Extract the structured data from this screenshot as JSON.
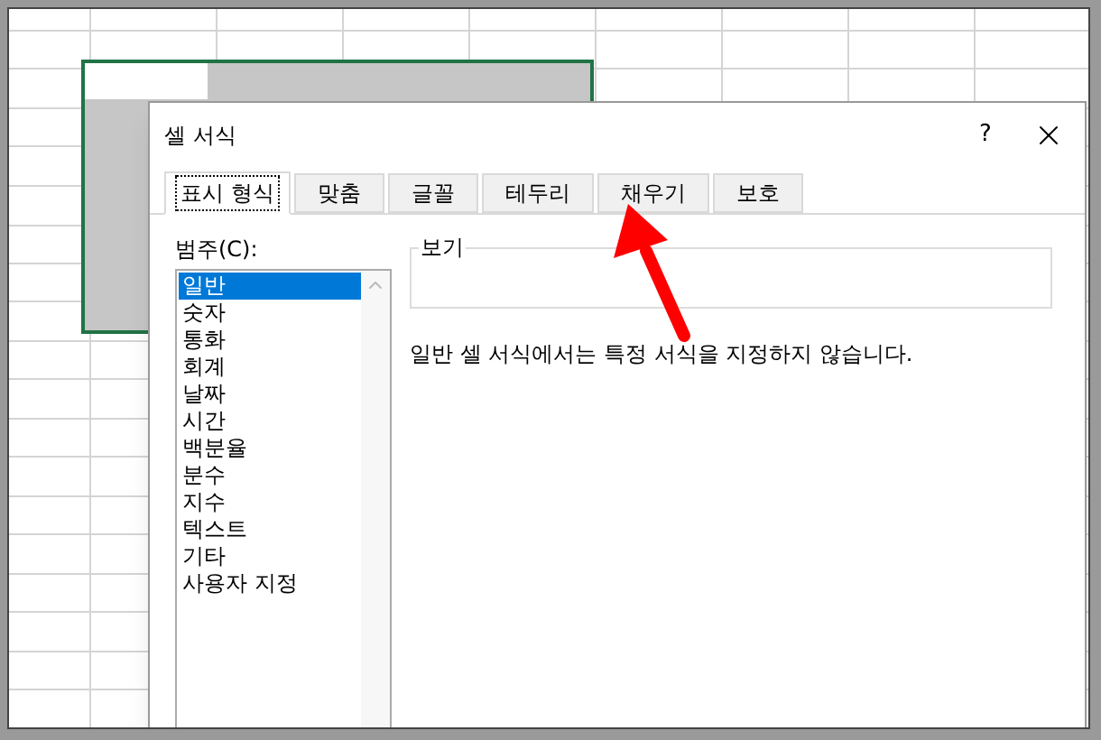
{
  "dialog": {
    "title": "셀 서식",
    "help": "?"
  },
  "tabs": [
    {
      "label": "표시 형식",
      "selected": true
    },
    {
      "label": "맞춤",
      "selected": false
    },
    {
      "label": "글꼴",
      "selected": false
    },
    {
      "label": "테두리",
      "selected": false
    },
    {
      "label": "채우기",
      "selected": false
    },
    {
      "label": "보호",
      "selected": false
    }
  ],
  "category": {
    "label": "범주(C):",
    "items": [
      {
        "label": "일반",
        "selected": true
      },
      {
        "label": "숫자",
        "selected": false
      },
      {
        "label": "통화",
        "selected": false
      },
      {
        "label": "회계",
        "selected": false
      },
      {
        "label": "날짜",
        "selected": false
      },
      {
        "label": "시간",
        "selected": false
      },
      {
        "label": "백분율",
        "selected": false
      },
      {
        "label": "분수",
        "selected": false
      },
      {
        "label": "지수",
        "selected": false
      },
      {
        "label": "텍스트",
        "selected": false
      },
      {
        "label": "기타",
        "selected": false
      },
      {
        "label": "사용자 지정",
        "selected": false
      }
    ]
  },
  "preview": {
    "label": "보기"
  },
  "description": "일반 셀 서식에서는 특정 서식을 지정하지 않습니다."
}
